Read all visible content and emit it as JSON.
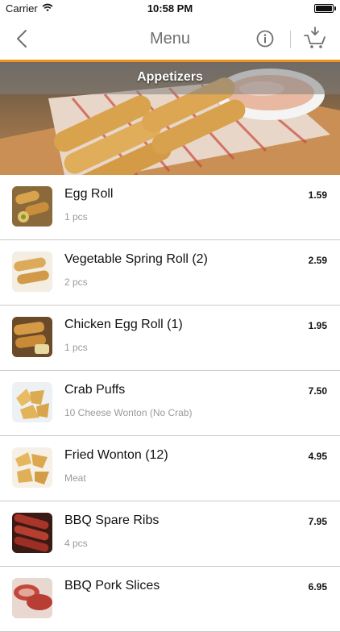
{
  "status_bar": {
    "carrier": "Carrier",
    "time": "10:58 PM"
  },
  "nav": {
    "title": "Menu",
    "back_icon": "chevron-left-icon",
    "info_icon": "info-icon",
    "cart_icon": "cart-add-icon",
    "accent_color": "#f0921e"
  },
  "category": {
    "title": "Appetizers"
  },
  "items": [
    {
      "name": "Egg Roll",
      "desc": "1 pcs",
      "price": "1.59"
    },
    {
      "name": "Vegetable Spring Roll (2)",
      "desc": "2 pcs",
      "price": "2.59"
    },
    {
      "name": "Chicken Egg Roll (1)",
      "desc": "1 pcs",
      "price": "1.95"
    },
    {
      "name": "Crab Puffs",
      "desc": "10 Cheese Wonton (No Crab)",
      "price": "7.50"
    },
    {
      "name": "Fried Wonton (12)",
      "desc": "Meat",
      "price": "4.95"
    },
    {
      "name": "BBQ Spare Ribs",
      "desc": "4 pcs",
      "price": "7.95"
    },
    {
      "name": "BBQ Pork Slices",
      "desc": "",
      "price": "6.95"
    }
  ]
}
